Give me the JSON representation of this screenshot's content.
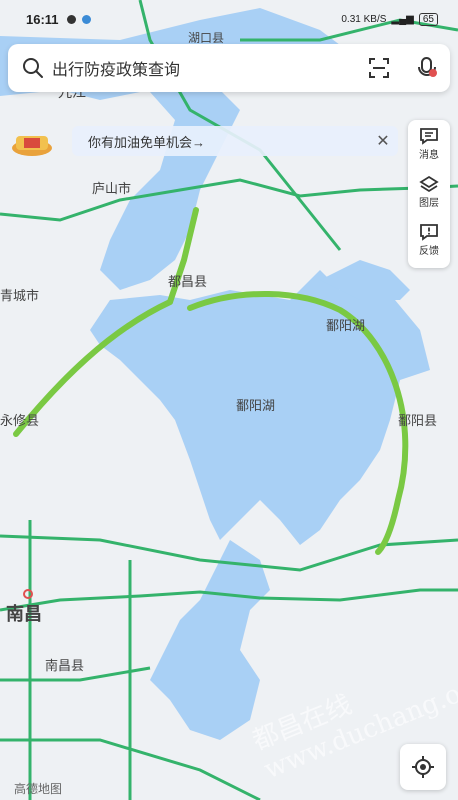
{
  "status": {
    "time": "16:11",
    "net_speed": "0.31 KB/S",
    "battery": "65"
  },
  "search": {
    "placeholder": "出行防疫政策查询"
  },
  "promo": {
    "text": "你有加油免单机会→"
  },
  "side_panel": [
    {
      "label": "消息",
      "icon": "message-icon"
    },
    {
      "label": "图层",
      "icon": "layers-icon"
    },
    {
      "label": "反馈",
      "icon": "feedback-icon"
    }
  ],
  "map_labels": {
    "hukou": "湖口县",
    "jiujiang": "九江",
    "lushan": "庐山市",
    "duchang": "都昌县",
    "gongqing": "青城市",
    "poyanghu_north": "鄱阳湖",
    "poyanghu_center": "鄱阳湖",
    "poyang_county": "鄱阳县",
    "yongxiu": "永修县",
    "nanchang": "南昌",
    "nanchang_county": "南昌县"
  },
  "attribution": "高德地图",
  "watermark": "都昌在线 www.duchang.org",
  "colors": {
    "water": "#a9d0f5",
    "road": "#34b36b",
    "route": "#7ac943",
    "land": "#eef1f4"
  }
}
